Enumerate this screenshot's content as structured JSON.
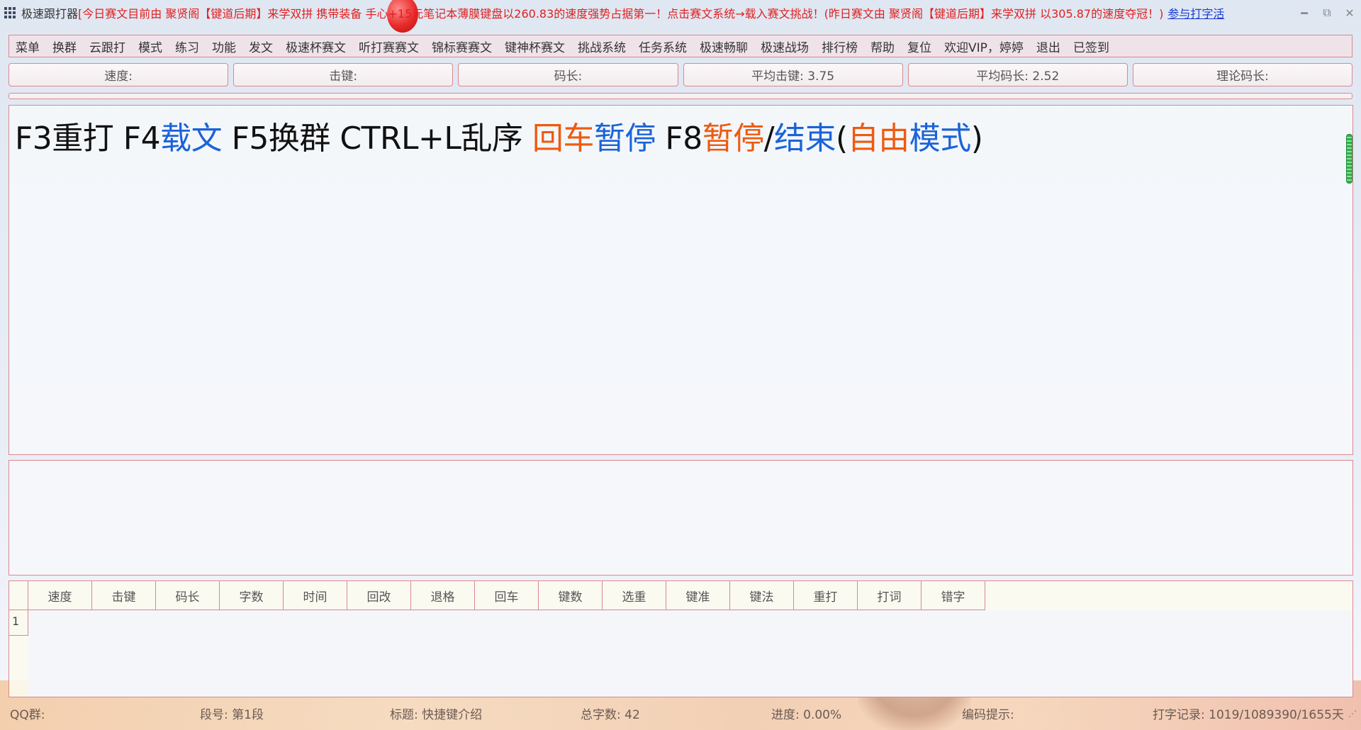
{
  "titlebar": {
    "app_name": "极速跟打器",
    "marquee": "[今日赛文目前由 聚贤阁【键道后期】来学双拼 携带装备 手心+15元笔记本薄膜键盘以260.83的速度强势占据第一！点击赛文系统→载入赛文挑战！(昨日赛文由 聚贤阁【键道后期】来学双拼 以305.87的速度夺冠！)",
    "link": "参与打字活",
    "minimize": "━",
    "restore": "⧉",
    "close": "✕"
  },
  "menu": {
    "items": [
      "菜单",
      "换群",
      "云跟打",
      "模式",
      "练习",
      "功能",
      "发文",
      "极速杯赛文",
      "听打赛赛文",
      "锦标赛赛文",
      "键神杯赛文",
      "挑战系统",
      "任务系统",
      "极速畅聊",
      "极速战场",
      "排行榜",
      "帮助",
      "复位",
      "欢迎VIP，婷婷",
      "退出",
      "已签到"
    ]
  },
  "stats": {
    "speed": "速度:",
    "keystroke": "击键:",
    "code_length": "码长:",
    "avg_keystroke": "平均击键: 3.75",
    "avg_code_length": "平均码长: 2.52",
    "theory_code_length": "理论码长:"
  },
  "text_panel": {
    "p1": "F3重打 F4",
    "p2": "载文",
    "p3": " F5换群 CTRL+L乱序 ",
    "p4": "回车",
    "p5": "暂停",
    "p6": " F8",
    "p7": "暂停",
    "p8": "/",
    "p9": "结束",
    "p10": "(",
    "p11": "自由",
    "p12": "模式",
    "p13": ")"
  },
  "table": {
    "columns": [
      "速度",
      "击键",
      "码长",
      "字数",
      "时间",
      "回改",
      "退格",
      "回车",
      "键数",
      "选重",
      "键准",
      "键法",
      "重打",
      "打词",
      "错字"
    ],
    "rows": [
      "1"
    ]
  },
  "status": {
    "qq_group": "QQ群:",
    "segment": "段号: 第1段",
    "title": "标题: 快捷键介绍",
    "total_chars": "总字数: 42",
    "progress": "进度: 0.00%",
    "encoding_hint": "编码提示:",
    "typing_record": "打字记录: 1019/1089390/1655天"
  },
  "colors": {
    "accent_border": "#d9898f",
    "marquee_red": "#e02020",
    "hint_blue": "#1b63d8",
    "hint_orange": "#ee5a12"
  }
}
